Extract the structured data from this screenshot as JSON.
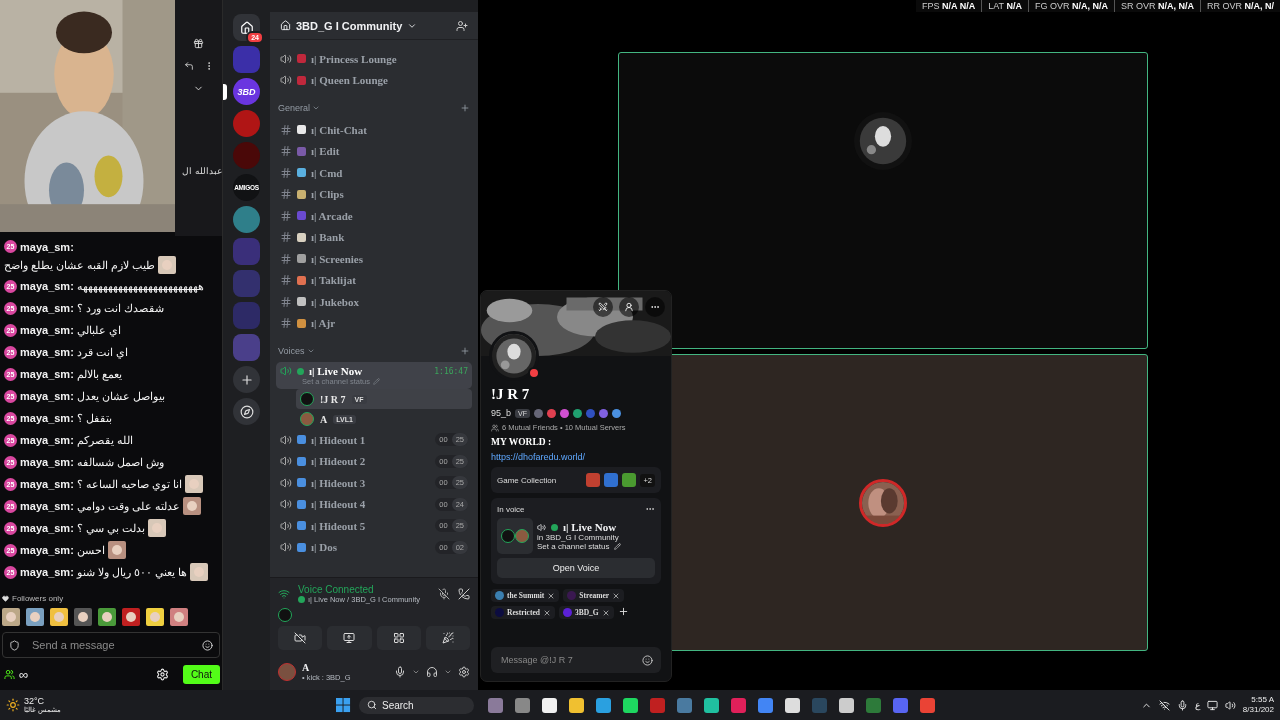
{
  "chat": {
    "side_name": "عبدالله ال",
    "messages": [
      {
        "badge": "25",
        "user": "maya_sm:",
        "text": "طيب لازم القبه عشان يطلع واضح",
        "emote": true
      },
      {
        "badge": "25",
        "user": "maya_sm:",
        "text": "ههههههههههههههههههههههههه",
        "emote": false
      },
      {
        "badge": "25",
        "user": "maya_sm:",
        "text": "شقصدك انت ورد ؟",
        "emote": false
      },
      {
        "badge": "25",
        "user": "maya_sm:",
        "text": "اي علبالي",
        "emote": false
      },
      {
        "badge": "25",
        "user": "maya_sm:",
        "text": "اي انت قرد",
        "emote": false
      },
      {
        "badge": "25",
        "user": "maya_sm:",
        "text": "يعمع بالالم",
        "emote": false
      },
      {
        "badge": "25",
        "user": "maya_sm:",
        "text": "بيواصل عشان يعدل",
        "emote": false
      },
      {
        "badge": "25",
        "user": "maya_sm:",
        "text": "بتقفل ؟",
        "emote": false
      },
      {
        "badge": "25",
        "user": "maya_sm:",
        "text": "الله يقصركم",
        "emote": false
      },
      {
        "badge": "25",
        "user": "maya_sm:",
        "text": "وش اصمل شسالفه",
        "emote": false
      },
      {
        "badge": "25",
        "user": "maya_sm:",
        "text": "انا توي صاحيه الساعه ؟",
        "emote": true
      },
      {
        "badge": "25",
        "user": "maya_sm:",
        "text": "عدلته على وقت دوامي",
        "emote": true
      },
      {
        "badge": "25",
        "user": "maya_sm:",
        "text": "بدلت بي سي ؟",
        "emote": true
      },
      {
        "badge": "25",
        "user": "maya_sm:",
        "text": "احسن",
        "emote": true
      },
      {
        "badge": "25",
        "user": "maya_sm:",
        "text": "ها يعني ٥٠٠ ريال ولا شنو",
        "emote": true
      }
    ],
    "mode": "Followers only",
    "placeholder": "Send a message",
    "viewers": "∞",
    "send": "Chat"
  },
  "servers": [
    {
      "badge": "24",
      "kind": "home",
      "selected": false,
      "color": "#313338"
    },
    {
      "kind": "folder",
      "selected": false,
      "color": "#3b2fa8"
    },
    {
      "kind": "server",
      "label": "3BD",
      "selected": true,
      "color": "#6a35e0"
    },
    {
      "kind": "server",
      "selected": false,
      "color": "#b01515"
    },
    {
      "kind": "server",
      "selected": false,
      "color": "#4a0808"
    },
    {
      "kind": "server",
      "label": "AMIGOS",
      "selected": false,
      "color": "#111214"
    },
    {
      "kind": "server",
      "selected": false,
      "color": "#2f7f8a"
    },
    {
      "kind": "folder",
      "selected": false,
      "color": "#3a2f7a"
    },
    {
      "kind": "folder",
      "selected": false,
      "color": "#33306e"
    },
    {
      "kind": "folder",
      "selected": false,
      "color": "#2d2a66"
    },
    {
      "kind": "folder",
      "selected": false,
      "color": "#4a3f8a"
    }
  ],
  "guild": {
    "name": "3BD_G I Community"
  },
  "channels": [
    {
      "kind": "voice",
      "name": "ı| Princess Lounge",
      "color": "#c0283c"
    },
    {
      "kind": "voice",
      "name": "ı| Queen Lounge",
      "color": "#c0283c"
    },
    {
      "kind": "category",
      "name": "General"
    },
    {
      "kind": "text",
      "name": "ı| Chit-Chat",
      "color": "#e8e8e8"
    },
    {
      "kind": "text",
      "name": "ı| Edit",
      "color": "#7a5aa8"
    },
    {
      "kind": "text",
      "name": "ı| Cmd",
      "color": "#5ab0e0"
    },
    {
      "kind": "text",
      "name": "ı| Clips",
      "color": "#c8b070"
    },
    {
      "kind": "text",
      "name": "ı| Arcade",
      "color": "#6a4ad0"
    },
    {
      "kind": "text",
      "name": "ı| Bank",
      "color": "#d8d0c0"
    },
    {
      "kind": "text",
      "name": "ı| Screenies",
      "color": "#a0a0a0"
    },
    {
      "kind": "text",
      "name": "ı| Taklijat",
      "color": "#e07050"
    },
    {
      "kind": "text",
      "name": "ı| Jukebox",
      "color": "#c0c0c0"
    },
    {
      "kind": "text",
      "name": "ı| Ajr",
      "color": "#d09040"
    },
    {
      "kind": "category",
      "name": "Voices"
    },
    {
      "kind": "live",
      "name": "ı| Live Now",
      "time": "1:16:47",
      "status": "Set a channel status",
      "selected": true,
      "members": [
        {
          "name": "!J R 7",
          "tag": "VF",
          "hovered": true
        },
        {
          "name": "A",
          "tag": "LVL1",
          "hovered": false
        }
      ]
    },
    {
      "kind": "voice2",
      "name": "ı| Hideout 1",
      "a": "00",
      "b": "25",
      "color": "#4a8fe0"
    },
    {
      "kind": "voice2",
      "name": "ı| Hideout 2",
      "a": "00",
      "b": "25",
      "color": "#4a8fe0"
    },
    {
      "kind": "voice2",
      "name": "ı| Hideout 3",
      "a": "00",
      "b": "25",
      "color": "#4a8fe0"
    },
    {
      "kind": "voice2",
      "name": "ı| Hideout 4",
      "a": "00",
      "b": "24",
      "color": "#4a8fe0"
    },
    {
      "kind": "voice2",
      "name": "ı| Hideout 5",
      "a": "00",
      "b": "25",
      "color": "#4a8fe0"
    },
    {
      "kind": "voice2",
      "name": "ı| Dos",
      "a": "00",
      "b": "02",
      "color": "#4a8fe0"
    }
  ],
  "voice": {
    "title": "Voice Connected",
    "channel": "ı| Live Now / 3BD_G I Community"
  },
  "user": {
    "name": "A",
    "status": "• kick : 3BD_G"
  },
  "overlay": [
    {
      "label": "FPS",
      "value": "N/A  N/A"
    },
    {
      "label": "LAT",
      "value": "N/A"
    },
    {
      "label": "FG OVR",
      "value": "N/A, N/A"
    },
    {
      "label": "SR OVR",
      "value": "N/A, N/A"
    },
    {
      "label": "RR OVR",
      "value": "N/A, N/"
    }
  ],
  "profile": {
    "name": "!J R 7",
    "handle": "95_b",
    "tag": "VF",
    "mutual": "6 Mutual Friends • 10 Mutual Servers",
    "bio": "MY WORLD :",
    "link": "https://dhofaredu.world/",
    "games_title": "Game Collection",
    "games_more": "+2",
    "in_voice": "In voice",
    "voice_channel": "ı| Live Now",
    "voice_guild": "in 3BD_G I Community",
    "voice_status": "Set a channel status",
    "open": "Open Voice",
    "roles": [
      {
        "name": "the Summit",
        "color": "#3b7fb0"
      },
      {
        "name": "Streamer",
        "color": "#3a1850"
      },
      {
        "name": "Restricted",
        "color": "#0c0c40"
      },
      {
        "name": "3BD_G",
        "color": "#5b21d6"
      }
    ],
    "message_placeholder": "Message @!J R 7"
  },
  "taskbar": {
    "temp": "32°C",
    "weather": "مشمس غالبًا",
    "search": "Search",
    "lang": "ع",
    "time": "5:55 A",
    "date": "8/31/202"
  }
}
